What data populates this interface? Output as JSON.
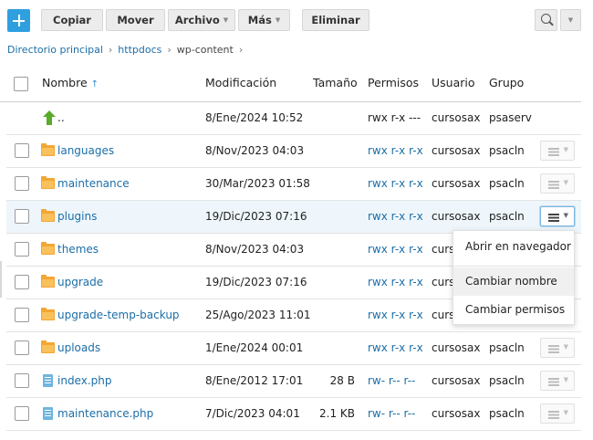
{
  "toolbar": {
    "copy_label": "Copiar",
    "move_label": "Mover",
    "file_label": "Archivo",
    "more_label": "Más",
    "delete_label": "Eliminar"
  },
  "breadcrumb": {
    "items": [
      "Directorio principal",
      "httpdocs",
      "wp-content"
    ]
  },
  "table": {
    "columns": {
      "name": "Nombre",
      "sort_arrow": "↑",
      "modified": "Modificación",
      "size": "Tamaño",
      "permissions": "Permisos",
      "user": "Usuario",
      "group": "Grupo"
    },
    "rows": [
      {
        "name": "..",
        "modified": "8/Ene/2024 10:52",
        "size": "",
        "permissions": "rwx r-x ---",
        "user": "cursosax",
        "group": "psaserv",
        "type": "parent"
      },
      {
        "name": "languages",
        "modified": "8/Nov/2023 04:03",
        "size": "",
        "permissions": "rwx r-x r-x",
        "user": "cursosax",
        "group": "psacln",
        "type": "folder"
      },
      {
        "name": "maintenance",
        "modified": "30/Mar/2023 01:58",
        "size": "",
        "permissions": "rwx r-x r-x",
        "user": "cursosax",
        "group": "psacln",
        "type": "folder"
      },
      {
        "name": "plugins",
        "modified": "19/Dic/2023 07:16",
        "size": "",
        "permissions": "rwx r-x r-x",
        "user": "cursosax",
        "group": "psacln",
        "type": "folder"
      },
      {
        "name": "themes",
        "modified": "8/Nov/2023 04:03",
        "size": "",
        "permissions": "rwx r-x r-x",
        "user": "cursosax",
        "group": "psacln",
        "type": "folder"
      },
      {
        "name": "upgrade",
        "modified": "19/Dic/2023 07:16",
        "size": "",
        "permissions": "rwx r-x r-x",
        "user": "cursosax",
        "group": "psacln",
        "type": "folder"
      },
      {
        "name": "upgrade-temp-backup",
        "modified": "25/Ago/2023 11:01",
        "size": "",
        "permissions": "rwx r-x r-x",
        "user": "cursosax",
        "group": "psacln",
        "type": "folder"
      },
      {
        "name": "uploads",
        "modified": "1/Ene/2024 00:01",
        "size": "",
        "permissions": "rwx r-x r-x",
        "user": "cursosax",
        "group": "psacln",
        "type": "folder"
      },
      {
        "name": "index.php",
        "modified": "8/Ene/2012 17:01",
        "size": "28 B",
        "permissions": "rw- r-- r--",
        "user": "cursosax",
        "group": "psacln",
        "type": "file"
      },
      {
        "name": "maintenance.php",
        "modified": "7/Dic/2023 04:01",
        "size": "2.1 KB",
        "permissions": "rw- r-- r--",
        "user": "cursosax",
        "group": "psacln",
        "type": "file"
      }
    ]
  },
  "context_menu": {
    "items": [
      "Abrir en navegador",
      "Cambiar nombre",
      "Cambiar permisos"
    ]
  },
  "colors": {
    "accent": "#2f9fe0",
    "link": "#1b6ea8",
    "folder": "#f4a633",
    "parent_arrow": "#5aab2a"
  }
}
